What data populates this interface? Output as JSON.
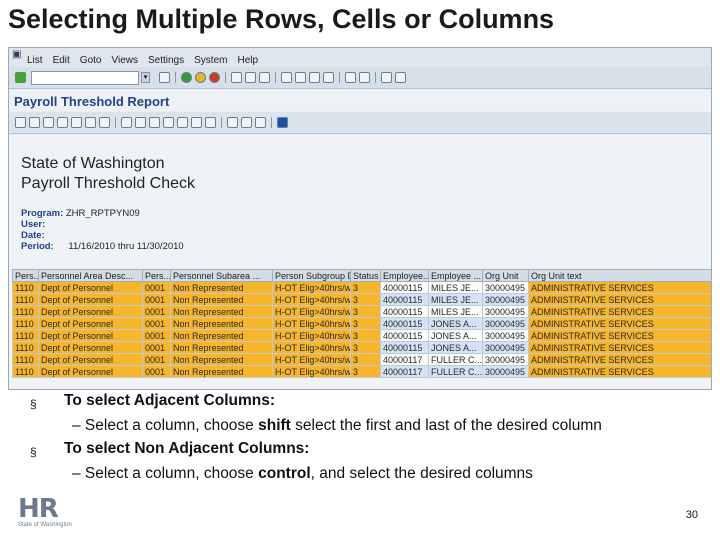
{
  "slide": {
    "title": "Selecting Multiple Rows, Cells or Columns",
    "page_number": "30"
  },
  "logo": {
    "text": "HR",
    "subtitle": "State of Washington"
  },
  "sap": {
    "menu_items": [
      "List",
      "Edit",
      "Goto",
      "Views",
      "Settings",
      "System",
      "Help"
    ],
    "report_title": "Payroll Threshold Report",
    "report": {
      "heading1": "State of Washington",
      "heading2": "Payroll Threshold Check",
      "program_label": "Program:",
      "program_value": "ZHR_RPTPYN09",
      "user_label": "User:",
      "user_value": "",
      "date_label": "Date:",
      "date_value": "",
      "period_label": "Period:",
      "period_value": "11/16/2010 thru 11/30/2010"
    },
    "table": {
      "columns": [
        "Pers...",
        "Personnel Area Desc...",
        "Pers...",
        "Personnel Subarea ...",
        "Person Subgroup Desc",
        "Status",
        "Employee...",
        "Employee ...",
        "Org Unit",
        "Org Unit text"
      ],
      "rows": [
        [
          "1110",
          "Dept of Personnel",
          "0001",
          "Non Represented",
          "H-OT Elig>40hrs/wk",
          "3",
          "40000115",
          "MILES JE...",
          "30000495",
          "ADMINISTRATIVE SERVICES"
        ],
        [
          "1110",
          "Dept of Personnel",
          "0001",
          "Non Represented",
          "H-OT Elig>40hrs/wk",
          "3",
          "40000115",
          "MILES JE...",
          "30000495",
          "ADMINISTRATIVE SERVICES"
        ],
        [
          "1110",
          "Dept of Personnel",
          "0001",
          "Non Represented",
          "H-OT Elig>40hrs/wk",
          "3",
          "40000115",
          "MILES JE...",
          "30000495",
          "ADMINISTRATIVE SERVICES"
        ],
        [
          "1110",
          "Dept of Personnel",
          "0001",
          "Non Represented",
          "H-OT Elig>40hrs/wk",
          "3",
          "40000115",
          "JONES A...",
          "30000495",
          "ADMINISTRATIVE SERVICES"
        ],
        [
          "1110",
          "Dept of Personnel",
          "0001",
          "Non Represented",
          "H-OT Elig>40hrs/wk",
          "3",
          "40000115",
          "JONES A...",
          "30000495",
          "ADMINISTRATIVE SERVICES"
        ],
        [
          "1110",
          "Dept of Personnel",
          "0001",
          "Non Represented",
          "H-OT Elig>40hrs/wk",
          "3",
          "40000115",
          "JONES A...",
          "30000495",
          "ADMINISTRATIVE SERVICES"
        ],
        [
          "1110",
          "Dept of Personnel",
          "0001",
          "Non Represented",
          "H-OT Elig>40hrs/wk",
          "3",
          "40000117",
          "FULLER C...",
          "30000495",
          "ADMINISTRATIVE SERVICES"
        ],
        [
          "1110",
          "Dept of Personnel",
          "0001",
          "Non Represented",
          "H-OT Elig>40hrs/wk",
          "3",
          "40000117",
          "FULLER C...",
          "30000495",
          "ADMINISTRATIVE SERVICES"
        ]
      ]
    }
  },
  "bullets": {
    "marker": "§",
    "items": [
      {
        "head": "To select Adjacent Columns:",
        "sub_pre": "– Select a column, choose ",
        "sub_em": "shift",
        "sub_post": " select the first and last of the desired column"
      },
      {
        "head": "To select Non Adjacent Columns:",
        "sub_pre": "– Select a column, choose ",
        "sub_em": "control",
        "sub_post": ", and select the desired columns"
      }
    ]
  },
  "colors": {
    "title_blue": "#21438a",
    "selection_orange": "#f7b52b",
    "sap_background": "#e9eef4"
  }
}
